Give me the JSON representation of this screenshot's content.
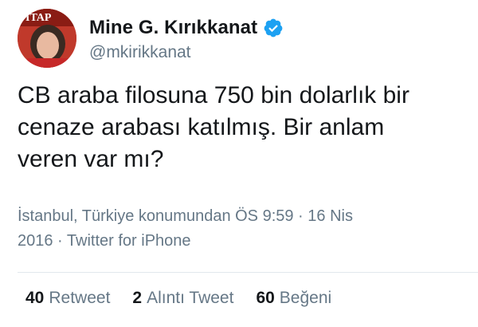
{
  "tweet": {
    "author": {
      "display_name": "Mine G. Kırıkkanat",
      "handle": "@mkirikkanat",
      "verified": true,
      "avatar_badge_text": "ITAP"
    },
    "text": "CB araba filosuna 750 bin dolarlık bir\ncenaze arabası katılmış. Bir anlam\nveren var mı?",
    "meta": "İstanbul, Türkiye konumundan ÖS 9:59 · 16 Nis\n2016 · Twitter for iPhone",
    "stats": {
      "retweets": {
        "count": "40",
        "label": "Retweet"
      },
      "quotes": {
        "count": "2",
        "label": "Alıntı Tweet"
      },
      "likes": {
        "count": "60",
        "label": "Beğeni"
      }
    }
  },
  "colors": {
    "verified_badge": "#1da1f2",
    "secondary_text": "#657786",
    "primary_text": "#14171a",
    "divider": "#e1e8ed"
  },
  "icons": {
    "verified": "verified-badge-icon"
  }
}
